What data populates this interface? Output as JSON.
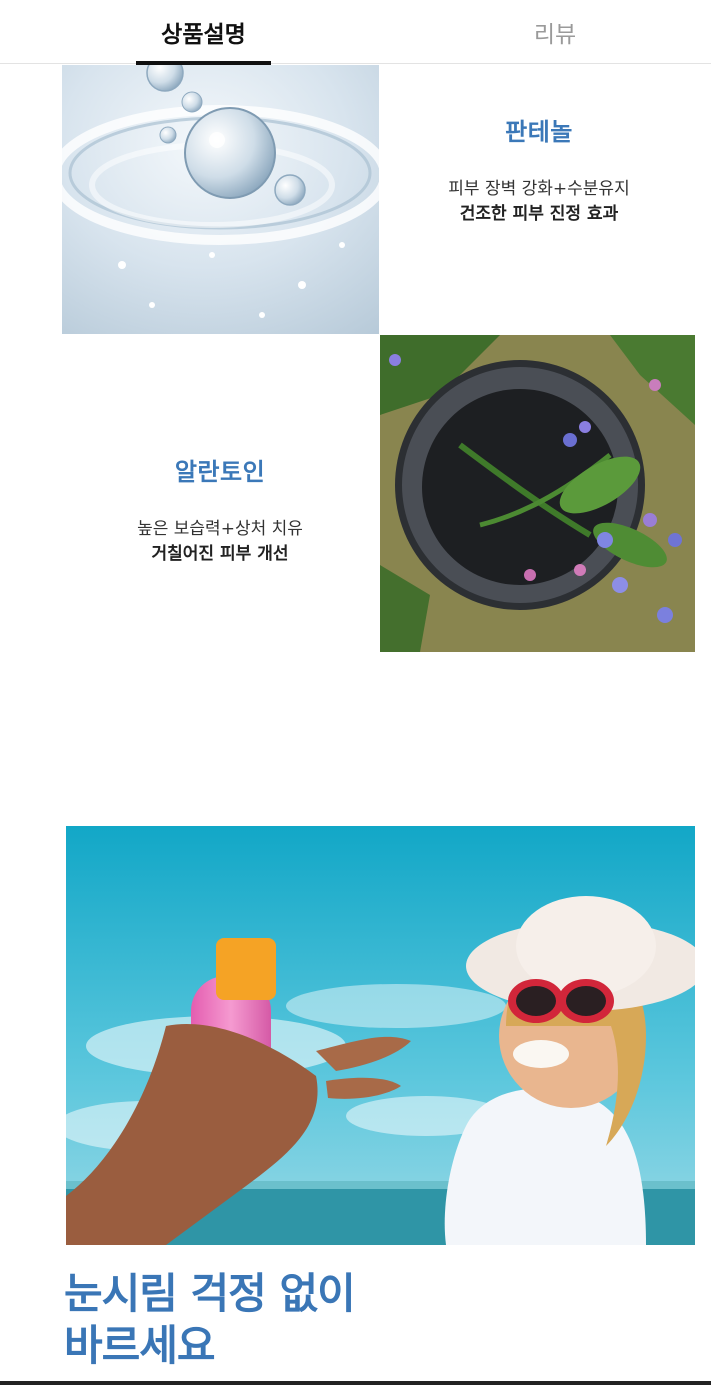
{
  "tabs": {
    "description": "상품설명",
    "review": "리뷰"
  },
  "ingredients": [
    {
      "title": "판테놀",
      "line1": "피부 장벽 강화+수분유지",
      "line2": "건조한 피부 진정 효과",
      "image_icon": "water-droplet-image"
    },
    {
      "title": "알란토인",
      "line1": "높은 보습력+상처 치유",
      "line2": "거칠어진 피부 개선",
      "image_icon": "comfrey-flower-mortar-image"
    }
  ],
  "promo": {
    "image_icon": "child-sunscreen-beach-image",
    "headline_line1": "눈시림 걱정 없이",
    "headline_line2": "바르세요"
  },
  "colors": {
    "accent": "#3b78b8",
    "tab_active": "#111111",
    "tab_inactive": "#9a9a9a"
  }
}
